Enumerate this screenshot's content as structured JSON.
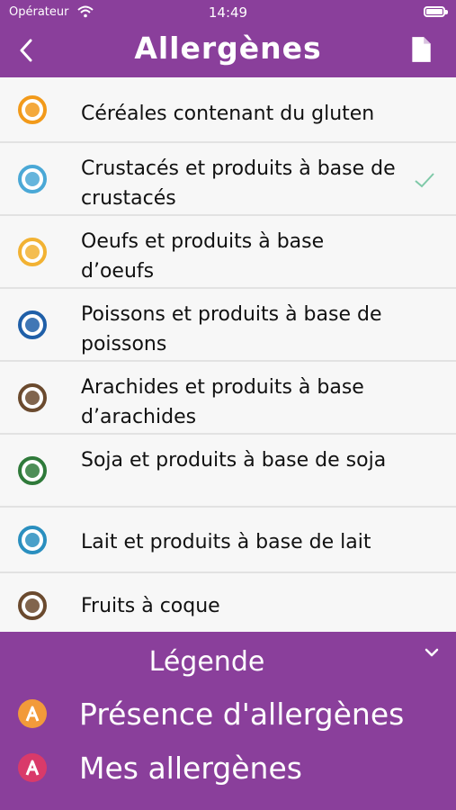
{
  "status_bar": {
    "carrier": "Opérateur",
    "time": "14:49"
  },
  "nav": {
    "title": "Allergènes"
  },
  "allergens": [
    {
      "label": "Céréales contenant du gluten",
      "color": "#f29a1a",
      "icon": "wheat-icon",
      "checked": false
    },
    {
      "label": "Crustacés et produits à base de crustacés",
      "color": "#4aa8d6",
      "icon": "shell-icon",
      "checked": true
    },
    {
      "label": "Oeufs et produits à base d’oeufs",
      "color": "#f2b233",
      "icon": "egg-icon",
      "checked": false
    },
    {
      "label": "Poissons et produits à base de poissons",
      "color": "#1f5fa8",
      "icon": "fish-icon",
      "checked": false
    },
    {
      "label": "Arachides et produits à base d’arachides",
      "color": "#6b4a2e",
      "icon": "peanut-icon",
      "checked": false
    },
    {
      "label": "Soja et produits à base de soja",
      "color": "#2f7a3a",
      "icon": "soy-icon",
      "checked": false
    },
    {
      "label": "Lait et produits à base de lait",
      "color": "#2a8fbf",
      "icon": "milk-icon",
      "checked": false
    },
    {
      "label": "Fruits à coque",
      "color": "#6b4a2e",
      "icon": "nut-icon",
      "checked": false
    }
  ],
  "legend": {
    "title": "Légende",
    "items": [
      {
        "badge": "A",
        "label": "Présence d'allergènes",
        "color": "#f29a3a"
      },
      {
        "badge": "A",
        "label": "Mes allergènes",
        "color": "#d93a6a"
      }
    ]
  },
  "colors": {
    "primary": "#8a3f9b",
    "check": "#7fc9a8"
  }
}
